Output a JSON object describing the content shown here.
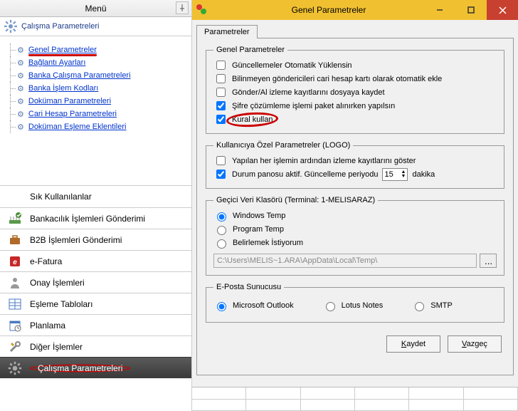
{
  "left": {
    "title": "Menü",
    "tab": "Çalışma Parametreleri",
    "tree": [
      "Genel Parametreler",
      "Bağlantı Ayarları",
      "Banka Çalışma Parametreleri",
      "Banka İşlem Kodları",
      "Doküman Parametreleri",
      "Cari Hesap Parametreleri",
      "Doküman Eşleme Eklentileri"
    ],
    "menu": [
      "Sık Kullanılanlar",
      "Bankacılık İşlemleri Gönderimi",
      "B2B İşlemleri Gönderimi",
      "e-Fatura",
      "Onay İşlemleri",
      "Eşleme Tabloları",
      "Planlama",
      "Diğer İşlemler",
      "Çalışma Parametreleri"
    ]
  },
  "right": {
    "title": "Genel Parametreler",
    "tab": "Parametreler",
    "group1": {
      "legend": "Genel Parametreler",
      "opts": [
        {
          "label": "Güncellemeler Otomatik Yüklensin",
          "checked": false
        },
        {
          "label": "Bilinmeyen göndericileri cari hesap kartı olarak otomatik ekle",
          "checked": false
        },
        {
          "label": "Gönder/Al izleme kayıtlarını dosyaya kaydet",
          "checked": false
        },
        {
          "label": "Şifre çözümleme işlemi paket alınırken yapılsın",
          "checked": true
        },
        {
          "label": "Kural kullan",
          "checked": true
        }
      ]
    },
    "group2": {
      "legend": "Kullanıcıya Özel Parametreler  (LOGO)",
      "opt1": {
        "label": "Yapılan her işlemin ardından izleme kayıtlarını göster",
        "checked": false
      },
      "opt2": {
        "label": "Durum panosu aktif. Güncelleme periyodu",
        "checked": true
      },
      "period_value": "15",
      "period_unit": "dakika"
    },
    "group3": {
      "legend": "Geçici Veri Klasörü (Terminal: 1-MELISARAZ)",
      "radios": [
        "Windows Temp",
        "Program Temp",
        "Belirlemek İstiyorum"
      ],
      "selected": 0,
      "path": "C:\\Users\\MELIS~1.ARA\\AppData\\Local\\Temp\\"
    },
    "group4": {
      "legend": "E-Posta Sunucusu",
      "radios": [
        "Microsoft Outlook",
        "Lotus Notes",
        "SMTP"
      ],
      "selected": 0
    },
    "buttons": {
      "save": "Kaydet",
      "cancel": "Vazgeç"
    }
  }
}
